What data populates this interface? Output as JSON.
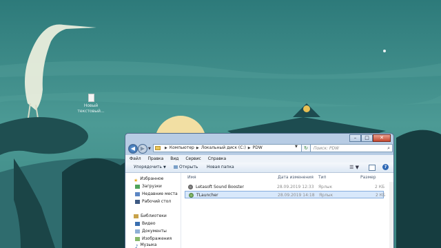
{
  "desktop": {
    "icons": [
      {
        "name": "Новый текстовый...",
        "lines": [
          "Новый",
          "текстовый..."
        ]
      }
    ]
  },
  "window": {
    "controls": {
      "minimize": "–",
      "maximize": "□",
      "close": "✕"
    },
    "navigation": {
      "back_glyph": "◀",
      "forward_glyph": "▶",
      "breadcrumb": [
        "Компьютер",
        "Локальный диск (C:)",
        "PDW"
      ],
      "refresh_glyph": "↻",
      "search_placeholder": "Поиск: PDW",
      "search_glyph": "⌕"
    },
    "menu": [
      "Файл",
      "Правка",
      "Вид",
      "Сервис",
      "Справка"
    ],
    "toolbar": {
      "organize": "Упорядочить",
      "open": "Открыть",
      "new_folder": "Новая папка",
      "views_glyph": "☰",
      "help_glyph": "?"
    },
    "sidebar": {
      "favorites_label": "Избранное",
      "favorites": [
        "Загрузки",
        "Недавние места",
        "Рабочий стол"
      ],
      "libraries_label": "Библиотеки",
      "libraries": [
        "Видео",
        "Документы",
        "Изображения",
        "Музыка"
      ]
    },
    "columns": [
      "Имя",
      "Дата изменения",
      "Тип",
      "Размер"
    ],
    "files": [
      {
        "name": "Letasoft Sound Booster",
        "date": "28.09.2019 12:33",
        "type": "Ярлык",
        "size": "2 КБ",
        "selected": false
      },
      {
        "name": "TLauncher",
        "date": "28.09.2019 14:18",
        "type": "Ярлык",
        "size": "2 КБ",
        "selected": true
      }
    ]
  },
  "colors": {
    "sky": "#3f8c8c",
    "sun": "#f2dfa3",
    "pagoda": "#1f4e52",
    "window_frame": "#b7cce4",
    "selection": "#d8e8fb"
  }
}
